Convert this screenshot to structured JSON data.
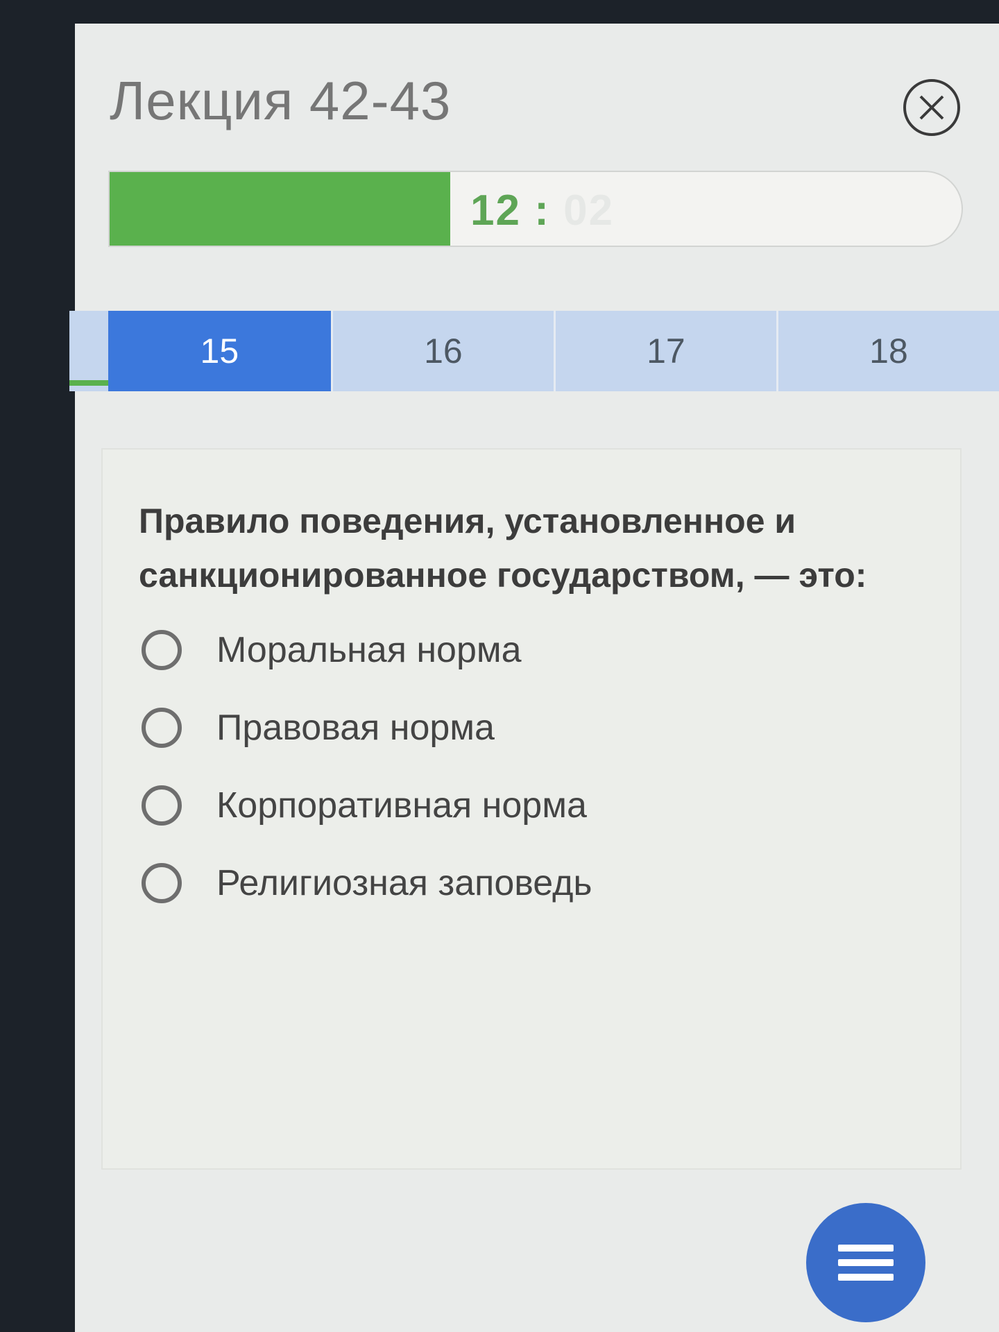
{
  "header": {
    "title": "Лекция 42-43"
  },
  "timer": {
    "minutes": "12",
    "separator": ":",
    "seconds": "02",
    "remaining_fraction": 0.4
  },
  "question_nav": {
    "tabs": [
      {
        "label": "15",
        "active": true
      },
      {
        "label": "16",
        "active": false
      },
      {
        "label": "17",
        "active": false
      },
      {
        "label": "18",
        "active": false
      }
    ]
  },
  "question": {
    "text": "Правило поведения, установленное и санкционированное государством, — это:",
    "options": [
      {
        "label": "Моральная норма"
      },
      {
        "label": "Правовая норма"
      },
      {
        "label": "Корпоративная норма"
      },
      {
        "label": "Религиозная заповедь"
      }
    ]
  },
  "icons": {
    "close": "close-icon",
    "menu": "menu-icon"
  },
  "colors": {
    "timer_fill": "#5ab14d",
    "active_tab": "#3c78dc",
    "inactive_tab": "#c5d6ee",
    "fab": "#3a6dc9"
  }
}
